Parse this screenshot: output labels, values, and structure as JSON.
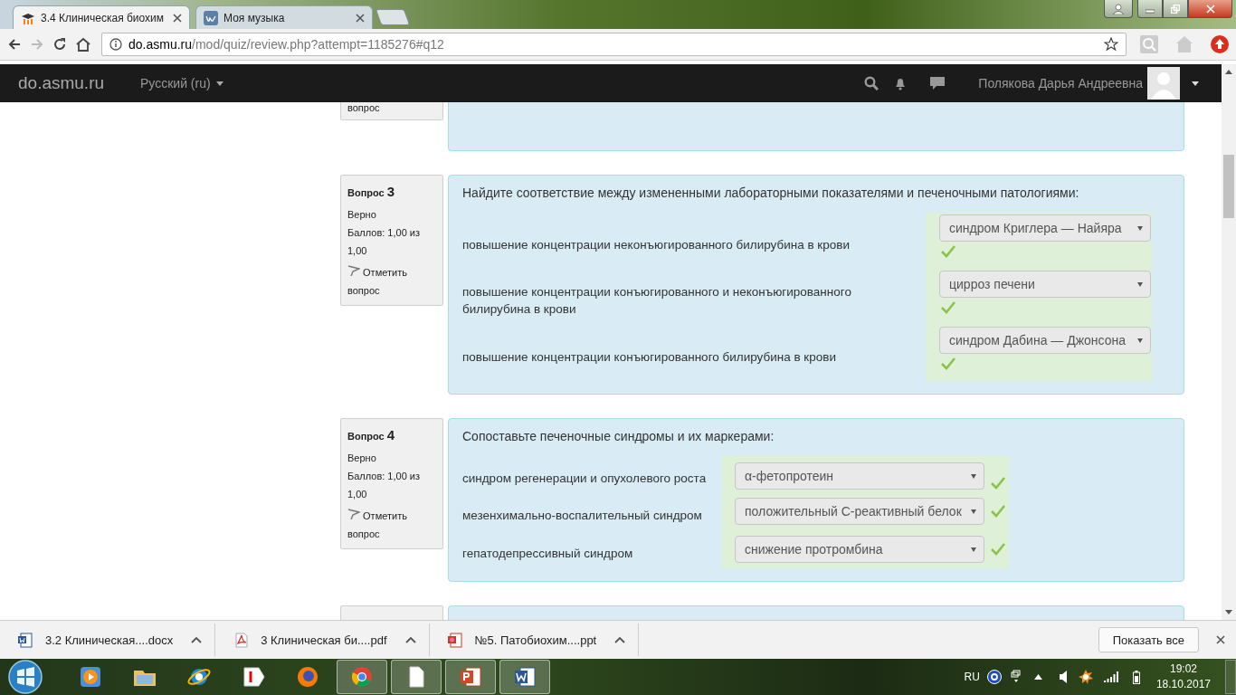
{
  "browser": {
    "tabs": [
      {
        "title": "3.4 Клиническая биохим",
        "kind": "moodle",
        "selected": true
      },
      {
        "title": "Моя музыка",
        "kind": "vk",
        "selected": false
      }
    ],
    "address": {
      "host": "do.asmu.ru",
      "path": "/mod/quiz/review.php?attempt=1185276#q12"
    }
  },
  "navbar": {
    "brand": "do.asmu.ru",
    "language": "Русский (ru)",
    "user": "Полякова Дарья Андреевна"
  },
  "partial_question": {
    "flag_text": "вопрос"
  },
  "questions": [
    {
      "label": "Вопрос",
      "number": "3",
      "state": "Верно",
      "grade": "Баллов: 1,00 из 1,00",
      "flag": "Отметить вопрос",
      "prompt": "Найдите соответствие между измененными лабораторными показателями и печеночными патологиями:",
      "kind": "stacked",
      "rows": [
        {
          "stem": "повышение концентрации неконъюгированного билирубина в крови",
          "answer": "синдром Криглера — Найяра",
          "correct": true
        },
        {
          "stem": "повышение концентрации конъюгированного и неконъюгированного билирубина в крови",
          "answer": "цирроз печени",
          "correct": true
        },
        {
          "stem": "повышение концентрации конъюгированного билирубина в крови",
          "answer": "синдром Дабина — Джонсона",
          "correct": true
        }
      ]
    },
    {
      "label": "Вопрос",
      "number": "4",
      "state": "Верно",
      "grade": "Баллов: 1,00 из 1,00",
      "flag": "Отметить вопрос",
      "prompt": "Сопоставьте печеночные синдромы и их маркерами:",
      "kind": "inline",
      "rows": [
        {
          "stem": "синдром регенерации и опухолевого роста",
          "answer": "α-фетопротеин",
          "correct": true
        },
        {
          "stem": "мезенхимально-воспалительный синдром",
          "answer": "положительный С-реактивный белок",
          "correct": true
        },
        {
          "stem": "гепатодепрессивный синдром",
          "answer": "снижение протромбина",
          "correct": true
        }
      ]
    }
  ],
  "downloads": {
    "items": [
      {
        "name": "3.2 Клиническая....docx",
        "kind": "word"
      },
      {
        "name": "3 Клиническая би....pdf",
        "kind": "pdf"
      },
      {
        "name": "№5. Патобиохим....ppt",
        "kind": "ppt"
      }
    ],
    "show_all": "Показать все"
  },
  "taskbar": {
    "apps": [
      {
        "kind": "media",
        "active": false
      },
      {
        "kind": "folder",
        "active": false
      },
      {
        "kind": "ie",
        "active": false
      },
      {
        "kind": "yandex",
        "active": false
      },
      {
        "kind": "firefox",
        "active": false
      },
      {
        "kind": "chrome",
        "active": true
      },
      {
        "kind": "blank",
        "active": true
      },
      {
        "kind": "ppt",
        "active": true
      },
      {
        "kind": "word",
        "active": true
      }
    ],
    "tray": {
      "language": "RU",
      "time": "19:02",
      "date": "18.10.2017"
    }
  }
}
